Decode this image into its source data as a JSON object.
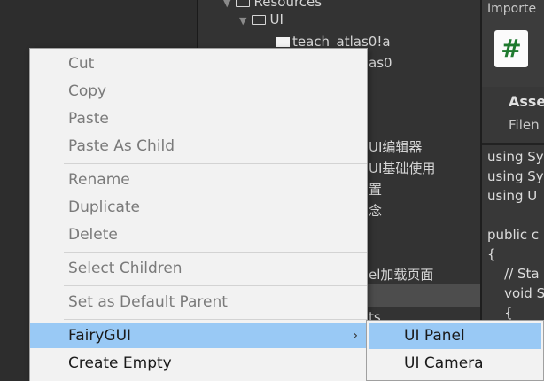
{
  "inspector": {
    "header": "Importe",
    "asset_label": "Asse",
    "filename_label": "Filen",
    "code_lines": [
      "using Sy",
      "using Sy",
      "using U",
      "",
      "public c",
      "{",
      "    // Sta",
      "    void S",
      "    {"
    ]
  },
  "project_tree": {
    "resources_label": "Resources",
    "ui_folder_label": "UI",
    "atlas_a_label": "teach_atlas0!a",
    "atlas0_label": "as0",
    "partial_items": [
      "UI编辑器",
      "UI基础使用",
      "置",
      "念",
      "el加载页面",
      "ts"
    ]
  },
  "context_menu": {
    "items": [
      {
        "label": "Cut",
        "disabled": true
      },
      {
        "label": "Copy",
        "disabled": true
      },
      {
        "label": "Paste",
        "disabled": true
      },
      {
        "label": "Paste As Child",
        "disabled": true
      },
      {
        "label": "Rename",
        "disabled": true
      },
      {
        "label": "Duplicate",
        "disabled": true
      },
      {
        "label": "Delete",
        "disabled": true
      },
      {
        "label": "Select Children",
        "disabled": true
      },
      {
        "label": "Set as Default Parent",
        "disabled": true
      },
      {
        "label": "FairyGUI",
        "disabled": false,
        "submenu": true
      },
      {
        "label": "Create Empty",
        "disabled": false
      }
    ],
    "submenu_arrow": "›"
  },
  "submenu": {
    "items": [
      {
        "label": "UI Panel"
      },
      {
        "label": "UI Camera"
      }
    ]
  }
}
